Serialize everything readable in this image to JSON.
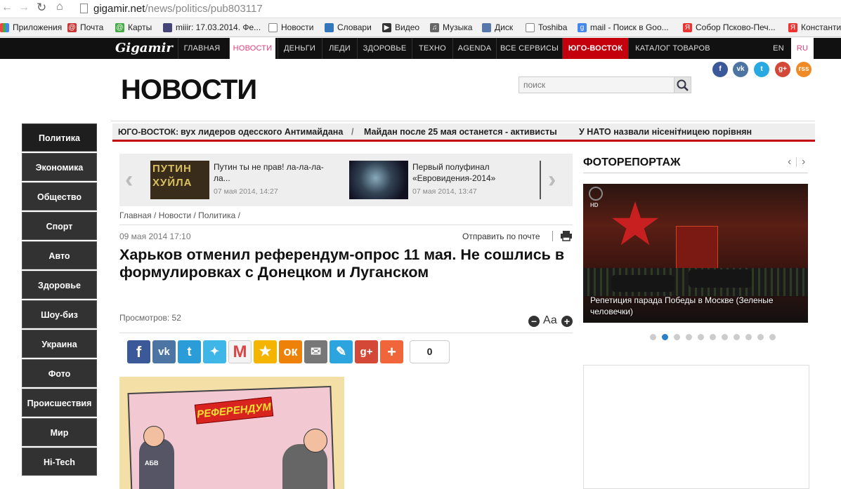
{
  "browser": {
    "url_host": "gigamir.net",
    "url_path": "/news/politics/pub803117",
    "bookmarks": [
      "Приложения",
      "Почта",
      "Карты",
      "miiir: 17.03.2014. Фе...",
      "Новости",
      "Словари",
      "Видео",
      "Музыка",
      "Диск",
      "Toshiba",
      "mail - Поиск в Goo...",
      "Собор Псково-Печ...",
      "Константи"
    ]
  },
  "site": {
    "logo": "Gigamir",
    "nav": [
      "ГЛАВНАЯ",
      "НОВОСТИ",
      "ДЕНЬГИ",
      "ЛЕДИ",
      "ЗДОРОВЬЕ",
      "ТЕХНО",
      "AGENDA",
      "ВСЕ СЕРВИСЫ",
      "ЮГО-ВОСТОК",
      "КАТАЛОГ ТОВАРОВ"
    ],
    "lang_en": "EN",
    "lang_ru": "RU",
    "section_title": "НОВОСТИ",
    "search_placeholder": "поиск",
    "social": [
      "f",
      "vk",
      "t",
      "g+",
      "rss"
    ]
  },
  "colors": {
    "accent_red": "#d00000",
    "nav_bg": "#111111",
    "active_nav": "#ffffff",
    "highlight_nav": "#c4000d"
  },
  "ticker": {
    "label": "ЮГО-ВОСТОК:",
    "items": [
      "вух лидеров одесского Антимайдана",
      "Майдан после 25 мая останется - активисты",
      "У НАТО назвали нісенітницею порівнян"
    ]
  },
  "sidebar": [
    "Политика",
    "Экономика",
    "Общество",
    "Спорт",
    "Авто",
    "Здоровье",
    "Шоу-биз",
    "Украина",
    "Фото",
    "Происшествия",
    "Мир",
    "Hi-Tech"
  ],
  "carousel": [
    {
      "title": "Путин ты не прав! ла-ла-ла-ла...",
      "date": "07 мая 2014, 14:27",
      "thumb_text": "ПУТИН\nХУЙЛА"
    },
    {
      "title": "Первый полуфинал «Евровидения-2014»",
      "date": "07 мая 2014, 13:47"
    }
  ],
  "breadcrumb": [
    "Главная",
    "Новости",
    "Политика"
  ],
  "article": {
    "date": "09 мая 2014 17:10",
    "send_mail": "Отправить по почте",
    "title": "Харьков отменил референдум-опрос 11 мая. Не сошлись в формулировках с Донецком и Луганском",
    "views": "Просмотров: 52",
    "font_label": "Аа",
    "share_count": "0",
    "image_banner": "РЕФЕРЕНДУМ",
    "image_label": "АБВ"
  },
  "photo": {
    "heading": "ФОТОРЕПОРТАЖ",
    "caption": "Репетиция парада Победы в Москве (Зеленые человечки)",
    "badge": "HD",
    "dots": 11,
    "active_dot": 1
  }
}
